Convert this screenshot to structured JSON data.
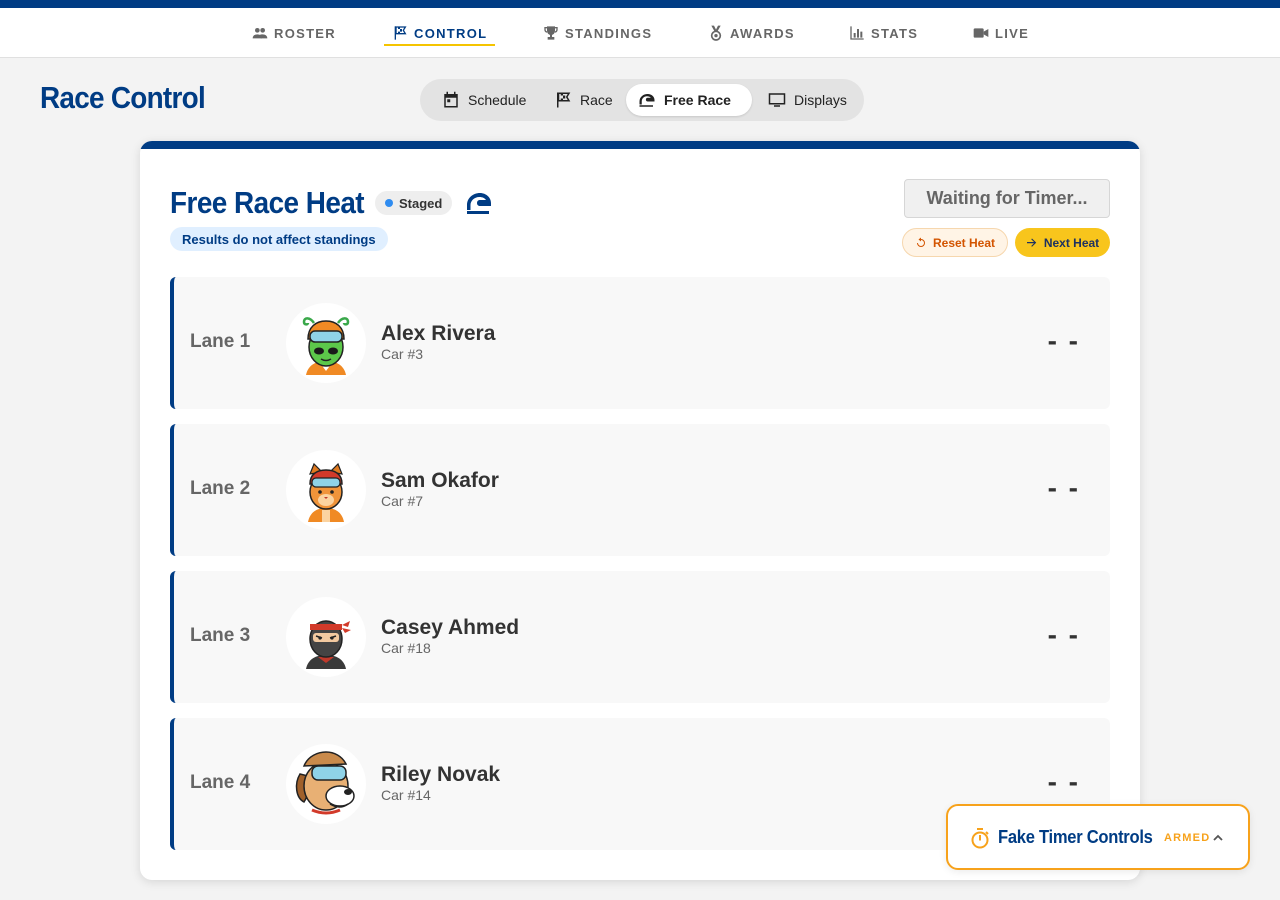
{
  "nav": {
    "items": [
      {
        "label": "ROSTER",
        "icon": "group-icon"
      },
      {
        "label": "CONTROL",
        "icon": "flag-icon",
        "active": true
      },
      {
        "label": "STANDINGS",
        "icon": "trophy-icon"
      },
      {
        "label": "AWARDS",
        "icon": "medal-icon"
      },
      {
        "label": "STATS",
        "icon": "bar-chart-icon"
      },
      {
        "label": "LIVE",
        "icon": "video-icon"
      }
    ]
  },
  "page": {
    "title": "Race Control"
  },
  "modes": {
    "tabs": [
      {
        "label": "Schedule",
        "icon": "calendar-icon"
      },
      {
        "label": "Race",
        "icon": "flag-icon"
      },
      {
        "label": "Free Race",
        "icon": "helmet-icon",
        "active": true
      },
      {
        "label": "Displays",
        "icon": "monitor-icon"
      }
    ]
  },
  "heat": {
    "title": "Free Race Heat",
    "status": "Staged",
    "note": "Results do not affect standings",
    "timer_status": "Waiting for Timer...",
    "reset_label": "Reset Heat",
    "next_label": "Next Heat"
  },
  "lanes": [
    {
      "label": "Lane 1",
      "name": "Alex Rivera",
      "car": "Car #3",
      "time": "- -",
      "avatar": "alien-avatar"
    },
    {
      "label": "Lane 2",
      "name": "Sam Okafor",
      "car": "Car #7",
      "time": "- -",
      "avatar": "cat-avatar"
    },
    {
      "label": "Lane 3",
      "name": "Casey Ahmed",
      "car": "Car #18",
      "time": "- -",
      "avatar": "ninja-avatar"
    },
    {
      "label": "Lane 4",
      "name": "Riley Novak",
      "car": "Car #14",
      "time": "- -",
      "avatar": "dog-avatar"
    }
  ],
  "fake_timer": {
    "title": "Fake Timer Controls",
    "state": "ARMED"
  },
  "colors": {
    "primary": "#003c84",
    "accent": "#f8c51c",
    "warning": "#f7a21b",
    "background": "#f3f3f3"
  }
}
